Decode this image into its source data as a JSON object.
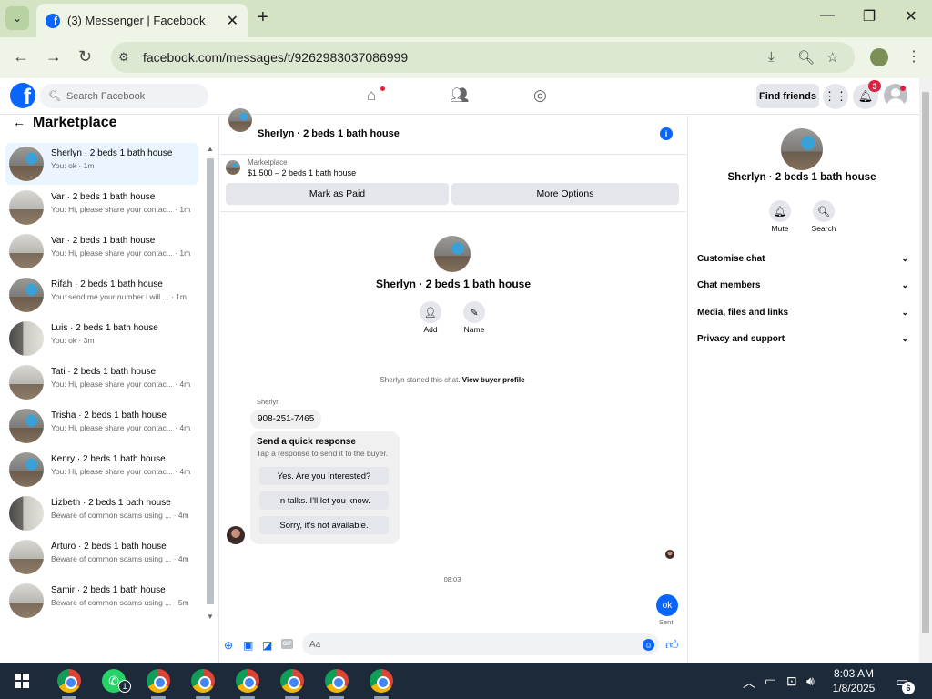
{
  "browser": {
    "tab_title": "(3) Messenger | Facebook",
    "url": "facebook.com/messages/t/9262983037086999"
  },
  "fb_header": {
    "search_placeholder": "Search Facebook",
    "find_friends": "Find friends",
    "notification_count": "3"
  },
  "left_panel": {
    "title": "Marketplace",
    "conversations": [
      {
        "name": "Sherlyn · 2 beds 1 bath house",
        "preview": "You: ok · 1m",
        "selected": true
      },
      {
        "name": "Var · 2 beds 1 bath house",
        "preview": "You: Hi, please share your contac... · 1m"
      },
      {
        "name": "Var · 2 beds 1 bath house",
        "preview": "You: Hi, please share your contac... · 1m"
      },
      {
        "name": "Rifah · 2 beds 1 bath house",
        "preview": "You: send me your number i will ... · 1m"
      },
      {
        "name": "Luis · 2 beds 1 bath house",
        "preview": "You: ok · 3m"
      },
      {
        "name": "Tati · 2 beds 1 bath house",
        "preview": "You: Hi, please share your contac... · 4m"
      },
      {
        "name": "Trisha · 2 beds 1 bath house",
        "preview": "You: Hi, please share your contac... · 4m"
      },
      {
        "name": "Kenry · 2 beds 1 bath house",
        "preview": "You: Hi, please share your contac... · 4m"
      },
      {
        "name": "Lizbeth · 2 beds 1 bath house",
        "preview": "Beware of common scams using ... · 4m"
      },
      {
        "name": "Arturo · 2 beds 1 bath house",
        "preview": "Beware of common scams using ... · 4m"
      },
      {
        "name": "Samir · 2 beds 1 bath house",
        "preview": "Beware of common scams using ... · 5m"
      }
    ]
  },
  "chat": {
    "header_name": "Sherlyn · 2 beds 1 bath house",
    "marketplace_label": "Marketplace",
    "listing": "$1,500 – 2 beds 1 bath house",
    "mark_paid": "Mark as Paid",
    "more_options": "More Options",
    "center_name": "Sherlyn · 2 beds 1 bath house",
    "add_label": "Add",
    "name_label": "Name",
    "started_text": "Sherlyn started this chat.",
    "view_buyer": "View buyer profile",
    "sender": "Sherlyn",
    "phone_message": "908-251-7465",
    "quick_title": "Send a quick response",
    "quick_sub": "Tap a response to send it to the buyer.",
    "quick_responses": [
      "Yes. Are you interested?",
      "In talks. I'll let you know.",
      "Sorry, it's not available."
    ],
    "time_separator": "08:03",
    "sent_message": "ok",
    "sent_status": "Sent",
    "composer_placeholder": "Aa"
  },
  "right_panel": {
    "name": "Sherlyn · 2 beds 1 bath house",
    "mute": "Mute",
    "search": "Search",
    "sections": [
      "Customise chat",
      "Chat members",
      "Media, files and links",
      "Privacy and support"
    ]
  },
  "taskbar": {
    "time": "8:03 AM",
    "date": "1/8/2025",
    "whatsapp_badge": "1",
    "notification_count": "6"
  }
}
